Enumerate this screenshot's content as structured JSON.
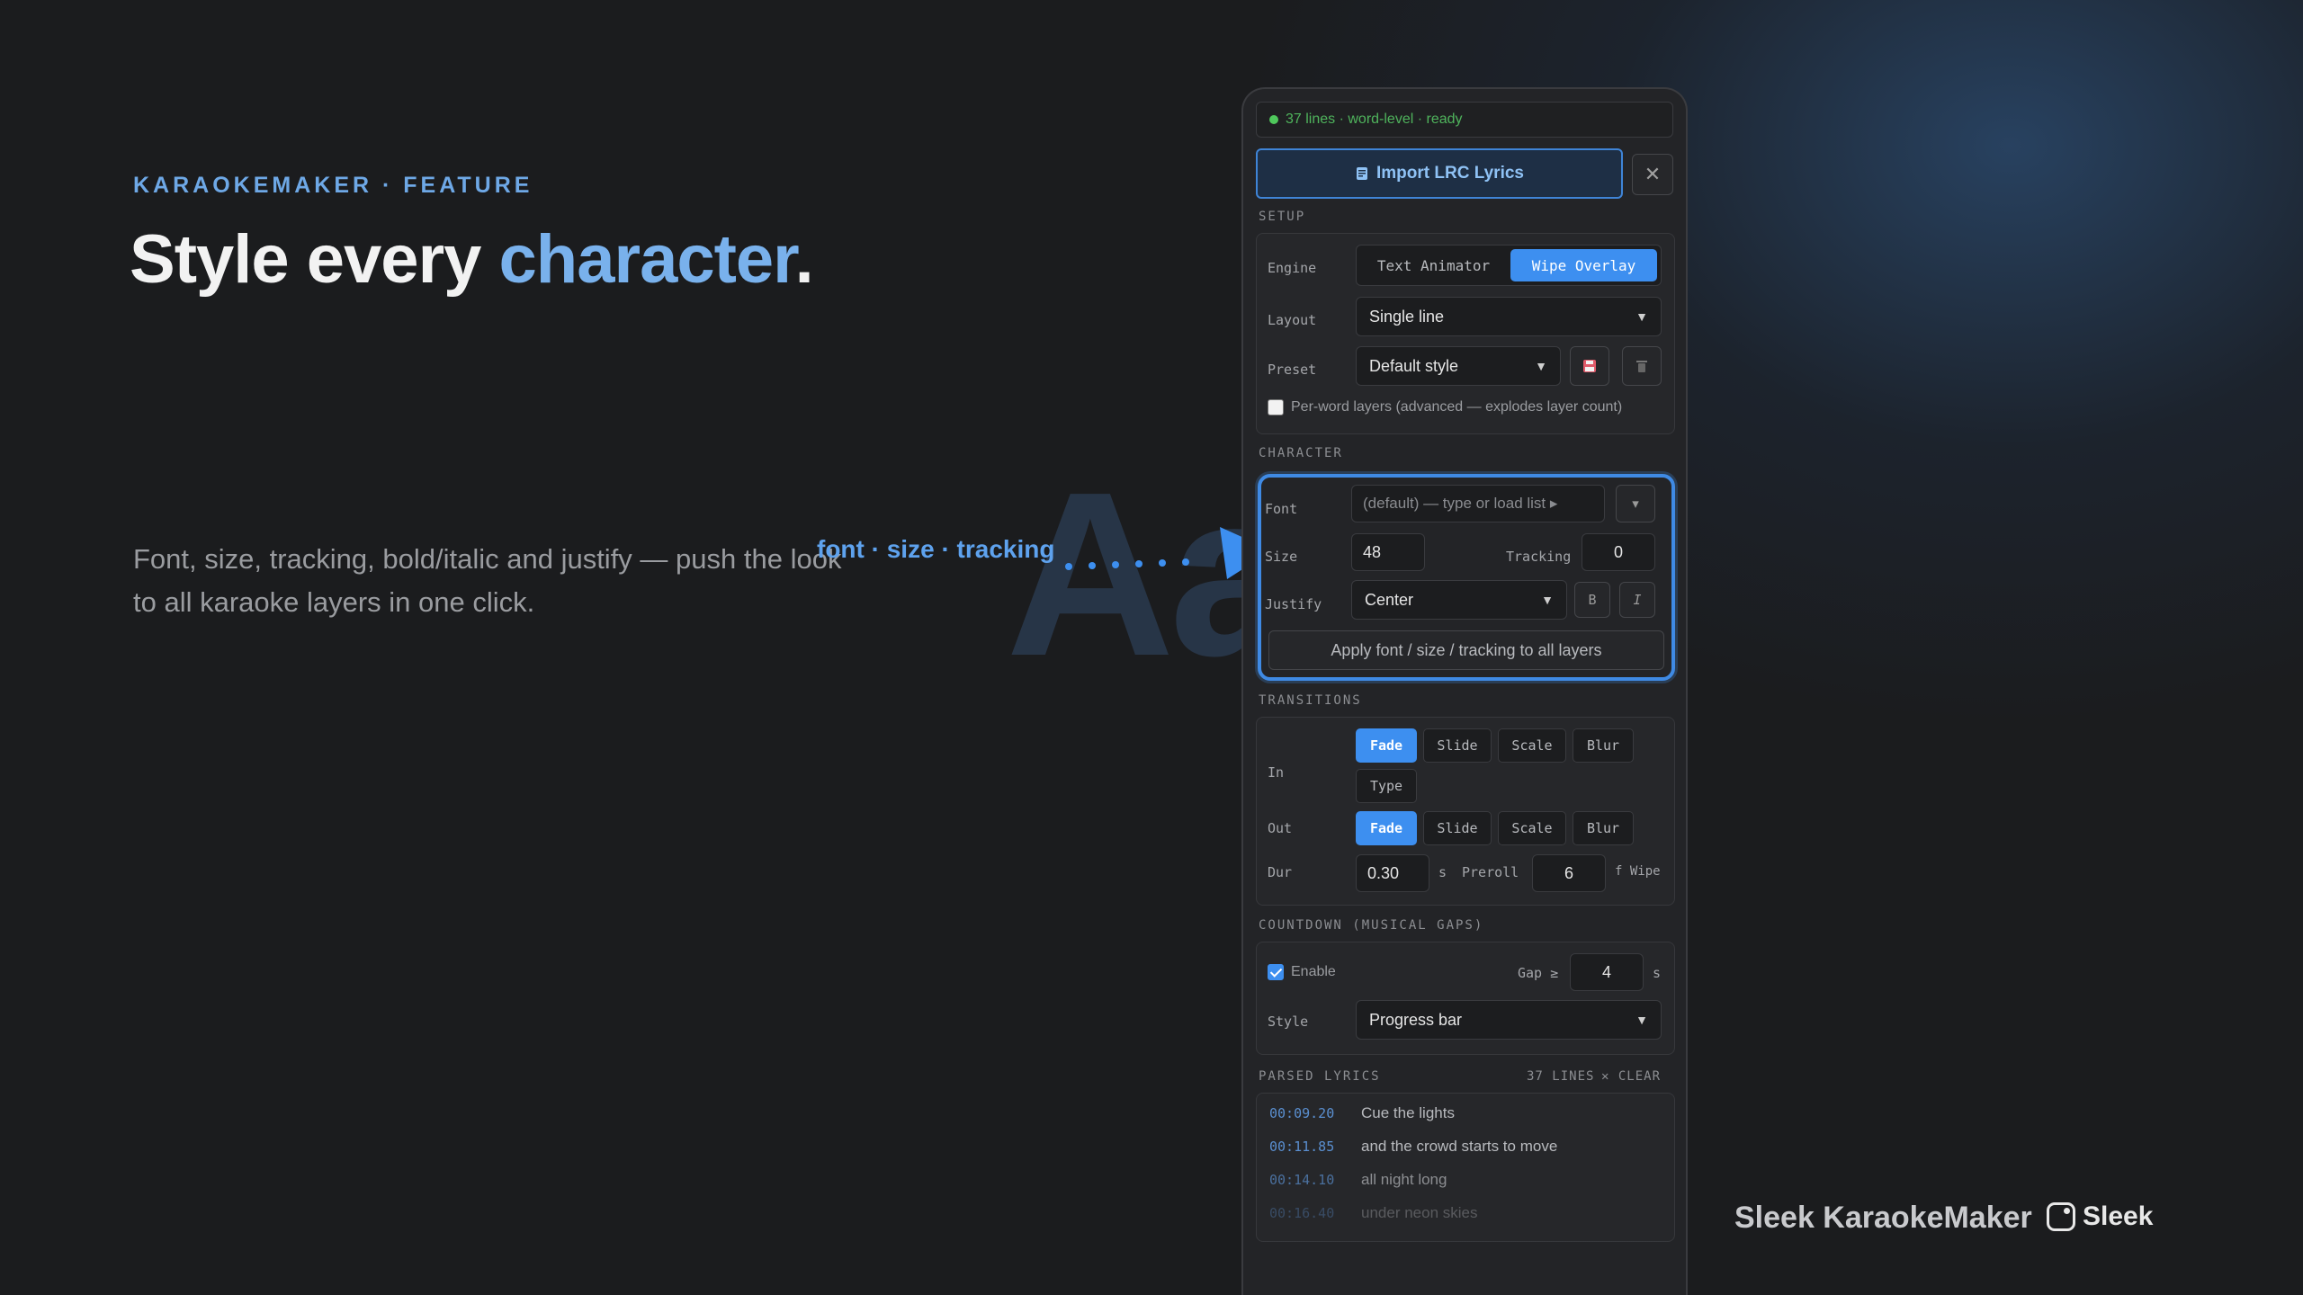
{
  "hero": {
    "eyebrow": "KARAOKEMAKER · FEATURE",
    "headline_pre": "Style every ",
    "headline_accent": "character",
    "headline_post": ".",
    "body": "Font, size, tracking, bold/italic and justify — push the look to all karaoke layers in one click.",
    "bg_glyph": "Aa",
    "callout": "font · size · tracking"
  },
  "panel": {
    "status": "37 lines · word-level · ready",
    "import_label": "Import LRC Lyrics",
    "import_icon": "lyrics-sheet-icon",
    "close_icon": "close-icon",
    "setup": {
      "title": "SETUP",
      "engine_label": "Engine",
      "engine_options": [
        "Text Animator",
        "Wipe Overlay"
      ],
      "engine_selected": "Wipe Overlay",
      "layout_label": "Layout",
      "layout_value": "Single line",
      "preset_label": "Preset",
      "preset_value": "Default style",
      "per_word_label": "Per-word layers (advanced — explodes layer count)",
      "per_word_checked": false
    },
    "character": {
      "title": "CHARACTER",
      "font_label": "Font",
      "font_placeholder": "(default) — type or load list ▸",
      "font_dropdown_glyph": "▾",
      "size_label": "Size",
      "size_value": "48",
      "tracking_label": "Tracking",
      "tracking_value": "0",
      "justify_label": "Justify",
      "justify_value": "Center",
      "bold_label": "B",
      "italic_label": "I",
      "apply_label": "Apply font / size / tracking to all layers"
    },
    "transitions": {
      "title": "TRANSITIONS",
      "in_label": "In",
      "in_options": [
        "Fade",
        "Slide",
        "Scale",
        "Blur",
        "Type"
      ],
      "in_selected": "Fade",
      "out_label": "Out",
      "out_options": [
        "Fade",
        "Slide",
        "Scale",
        "Blur"
      ],
      "out_selected": "Fade",
      "dur_label": "Dur",
      "dur_value": "0.30",
      "dur_unit": "s",
      "preroll_label": "Preroll",
      "preroll_value": "6",
      "preroll_unit": "f Wipe"
    },
    "countdown": {
      "title": "COUNTDOWN (MUSICAL GAPS)",
      "enable_label": "Enable",
      "enable_checked": true,
      "gap_label": "Gap ≥",
      "gap_value": "4",
      "gap_unit": "s",
      "style_label": "Style",
      "style_value": "Progress bar"
    },
    "parsed": {
      "title": "PARSED LYRICS",
      "count": "37 LINES",
      "clear_label": "✕ CLEAR",
      "lines": [
        {
          "time": "00:09.20",
          "text": "Cue the lights"
        },
        {
          "time": "00:11.85",
          "text": "and the crowd starts to move"
        },
        {
          "time": "00:14.10",
          "text": "all night long"
        },
        {
          "time": "00:16.40",
          "text": "under neon skies"
        }
      ]
    }
  },
  "brand": {
    "product": "Sleek KaraokeMaker",
    "logo_text": "Sleek"
  },
  "colors": {
    "accent": "#3d8ff0",
    "accent_text": "#79b1ec",
    "status": "#4fb35c",
    "background": "#1b1c1e"
  }
}
